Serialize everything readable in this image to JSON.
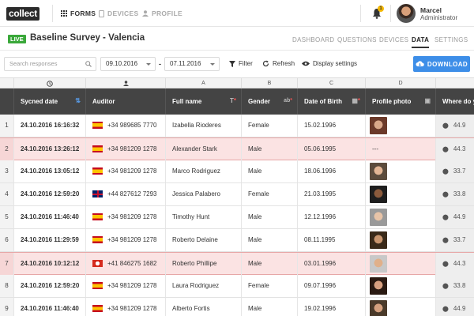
{
  "app": {
    "logo": "collect"
  },
  "nav": {
    "forms": "FORMS",
    "devices": "DEVICES",
    "profile": "PROFILE"
  },
  "notifications": {
    "count": "1"
  },
  "user": {
    "name": "Marcel",
    "role": "Administrator"
  },
  "survey": {
    "status": "LIVE",
    "title": "Baseline Survey - Valencia"
  },
  "tabs": [
    "DASHBOARD",
    "QUESTIONS",
    "DEVICES",
    "DATA",
    "SETTINGS"
  ],
  "active_tab": "DATA",
  "toolbar": {
    "search_placeholder": "Search responses",
    "date_from": "09.10.2016",
    "date_sep": "-",
    "date_to": "07.11.2016",
    "filter": "Filter",
    "refresh": "Refresh",
    "display": "Display settings",
    "download": "DOWNLOAD"
  },
  "columns": {
    "letters": [
      "A",
      "B",
      "C",
      "D"
    ],
    "headers": {
      "synced": "Sycned date",
      "auditor": "Auditor",
      "name": "Full name",
      "gender": "Gender",
      "dob": "Date of Birth",
      "photo": "Profile photo",
      "where": "Where do y"
    }
  },
  "rows": [
    {
      "n": "1",
      "synced": "24.10.2016 16:16:32",
      "flag": "es",
      "phone": "+34 989685 7770",
      "name": "Izabella Rioderes",
      "gender": "Female",
      "dob": "15.02.1996",
      "photo": "f1",
      "lat": "44.9",
      "hl": false
    },
    {
      "n": "2",
      "synced": "24.10.2016 13:26:12",
      "flag": "es",
      "phone": "+34 981209 1278",
      "name": "Alexander Stark",
      "gender": "Male",
      "dob": "05.06.1995",
      "photo": "---",
      "lat": "44.3",
      "hl": true
    },
    {
      "n": "3",
      "synced": "24.10.2016 13:05:12",
      "flag": "es",
      "phone": "+34 981209 1278",
      "name": "Marco Rodriguez",
      "gender": "Male",
      "dob": "18.06.1996",
      "photo": "m1",
      "lat": "33.7",
      "hl": false
    },
    {
      "n": "4",
      "synced": "24.10.2016 12:59:20",
      "flag": "uk",
      "phone": "+44 827612 7293",
      "name": "Jessica Palabero",
      "gender": "Female",
      "dob": "21.03.1995",
      "photo": "f2",
      "lat": "33.8",
      "hl": false
    },
    {
      "n": "5",
      "synced": "24.10.2016 11:46:40",
      "flag": "es",
      "phone": "+34 981209 1278",
      "name": "Timothy Hunt",
      "gender": "Male",
      "dob": "12.12.1996",
      "photo": "m2",
      "lat": "44.9",
      "hl": false
    },
    {
      "n": "6",
      "synced": "24.10.2016 11:29:59",
      "flag": "es",
      "phone": "+34 981209 1278",
      "name": "Roberto Delaine",
      "gender": "Male",
      "dob": "08.11.1995",
      "photo": "m3",
      "lat": "33.7",
      "hl": false
    },
    {
      "n": "7",
      "synced": "24.10.2016 10:12:12",
      "flag": "ch",
      "phone": "+41 846275 1682",
      "name": "Roberto Phillipe",
      "gender": "Male",
      "dob": "03.01.1996",
      "photo": "m4",
      "lat": "44.3",
      "hl": true
    },
    {
      "n": "8",
      "synced": "24.10.2016 12:59:20",
      "flag": "es",
      "phone": "+34 981209 1278",
      "name": "Laura Rodriguez",
      "gender": "Female",
      "dob": "09.07.1996",
      "photo": "f3",
      "lat": "33.8",
      "hl": false
    },
    {
      "n": "9",
      "synced": "24.10.2016 11:46:40",
      "flag": "es",
      "phone": "+34 981209 1278",
      "name": "Alberto Fortis",
      "gender": "Male",
      "dob": "19.02.1996",
      "photo": "m5",
      "lat": "44.9",
      "hl": false
    }
  ],
  "colors": {
    "accent": "#3d8ee8",
    "live": "#3aa83a",
    "highlight": "#fbe3e3",
    "header": "#444444"
  }
}
